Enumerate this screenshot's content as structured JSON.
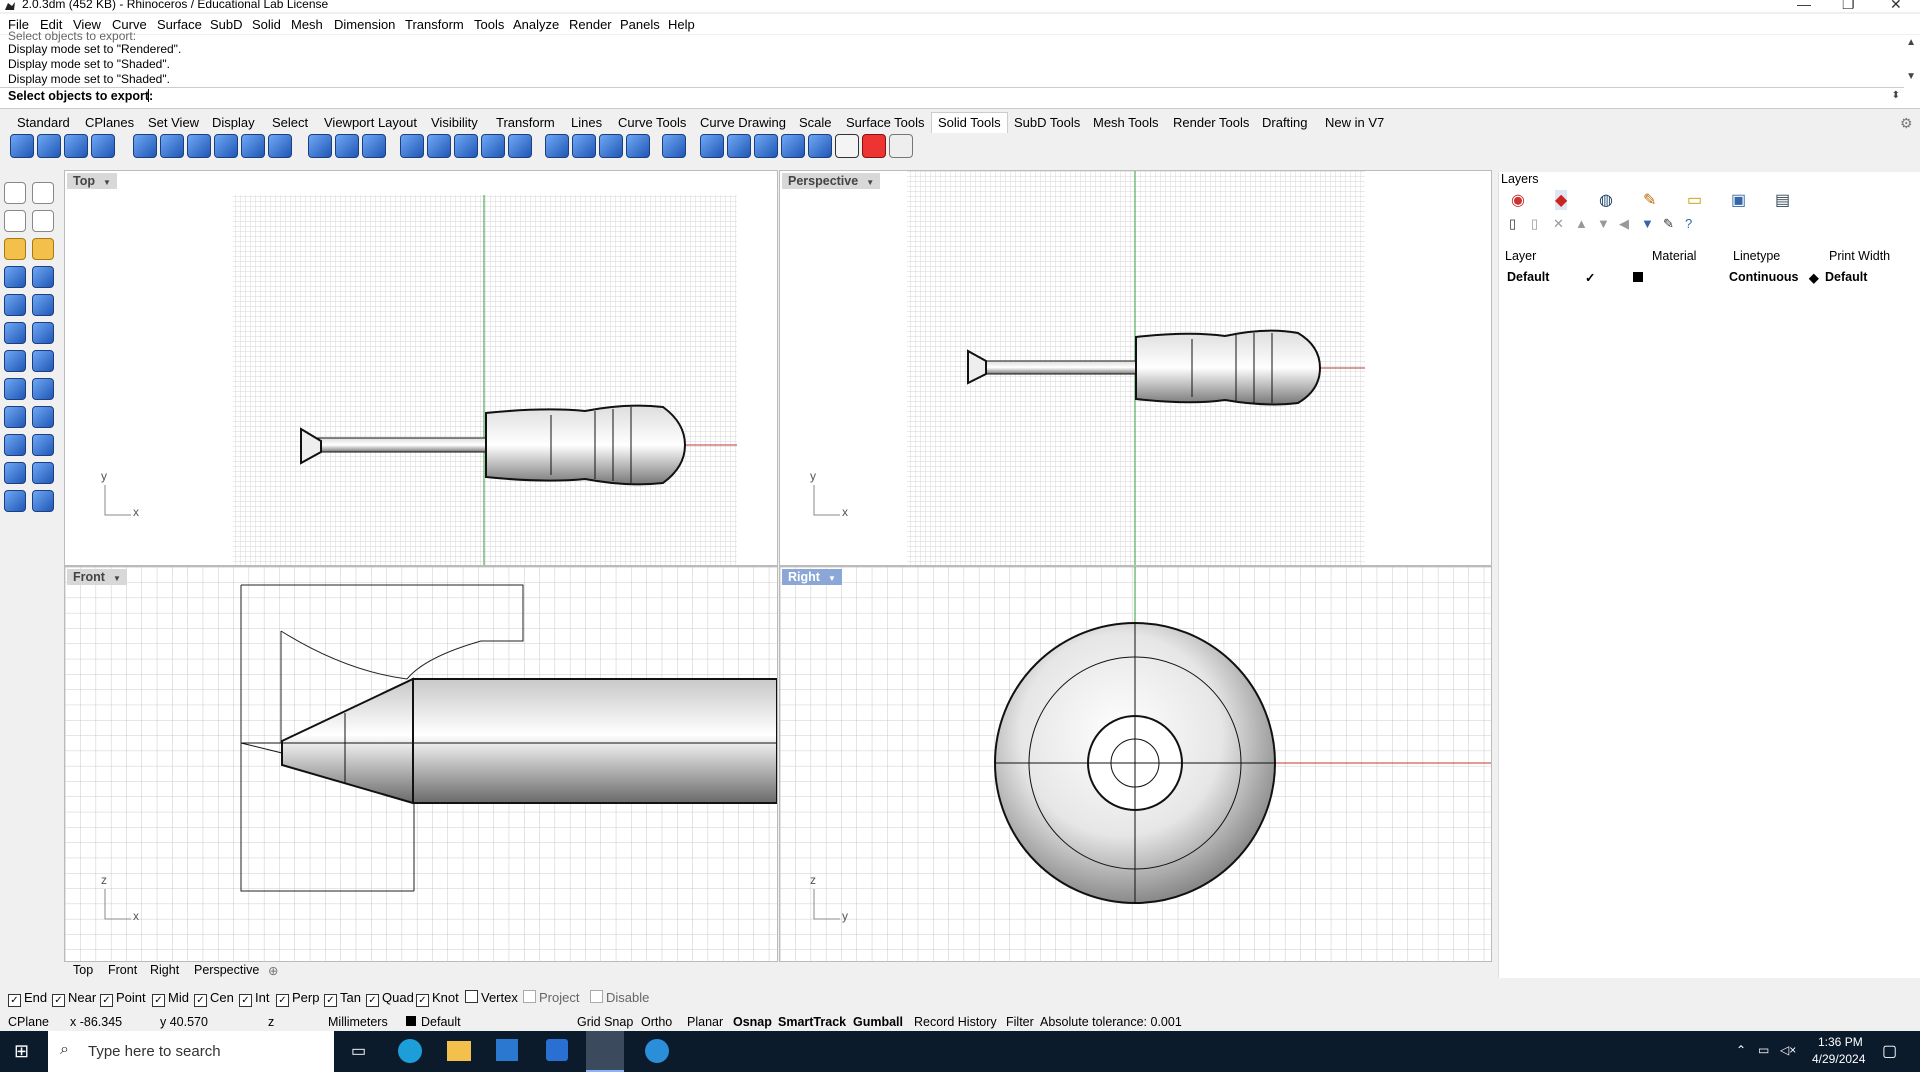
{
  "window": {
    "title": "2.0.3dm (452 KB) - Rhinoceros / Educational Lab License"
  },
  "menu": [
    "File",
    "Edit",
    "View",
    "Curve",
    "Surface",
    "SubD",
    "Solid",
    "Mesh",
    "Dimension",
    "Transform",
    "Tools",
    "Analyze",
    "Render",
    "Panels",
    "Help"
  ],
  "command": {
    "history": [
      "Select objects to export:",
      "Display mode set to \"Rendered\".",
      "Display mode set to \"Shaded\".",
      "Display mode set to \"Shaded\"."
    ],
    "prompt": "Select objects to export:"
  },
  "toolbar_tabs": [
    "Standard",
    "CPlanes",
    "Set View",
    "Display",
    "Select",
    "Viewport Layout",
    "Visibility",
    "Transform",
    "Lines",
    "Curve Tools",
    "Curve Drawing",
    "Scale",
    "Surface Tools",
    "Solid Tools",
    "SubD Tools",
    "Mesh Tools",
    "Render Tools",
    "Drafting",
    "New in V7"
  ],
  "active_tab": "Solid Tools",
  "viewports": {
    "top": "Top",
    "perspective": "Perspective",
    "front": "Front",
    "right": "Right"
  },
  "axis_labels": {
    "x": "x",
    "y": "y",
    "z": "z"
  },
  "view_tabs": [
    "Top",
    "Front",
    "Right",
    "Perspective"
  ],
  "layers": {
    "title": "Layers",
    "columns": [
      "Layer",
      "Material",
      "Linetype",
      "Print Width"
    ],
    "rows": [
      {
        "name": "Default",
        "check": "✓",
        "linetype": "Continuous",
        "print_width": "Default"
      }
    ]
  },
  "osnap": [
    {
      "label": "End",
      "checked": true
    },
    {
      "label": "Near",
      "checked": true
    },
    {
      "label": "Point",
      "checked": true
    },
    {
      "label": "Mid",
      "checked": true
    },
    {
      "label": "Cen",
      "checked": true
    },
    {
      "label": "Int",
      "checked": true
    },
    {
      "label": "Perp",
      "checked": true
    },
    {
      "label": "Tan",
      "checked": true
    },
    {
      "label": "Quad",
      "checked": true
    },
    {
      "label": "Knot",
      "checked": true
    },
    {
      "label": "Vertex",
      "checked": false
    },
    {
      "label": "Project",
      "checked": false
    },
    {
      "label": "Disable",
      "checked": false
    }
  ],
  "status": {
    "cplane": "CPlane",
    "x": "x -86.345",
    "y": "y 40.570",
    "z": "z",
    "units": "Millimeters",
    "layer": "Default",
    "toggles": [
      "Grid Snap",
      "Ortho",
      "Planar",
      "Osnap",
      "SmartTrack",
      "Gumball",
      "Record History",
      "Filter"
    ],
    "tolerance": "Absolute tolerance: 0.001"
  },
  "taskbar": {
    "search_placeholder": "Type here to search",
    "time": "1:36 PM",
    "date": "4/29/2024"
  },
  "colors": {
    "accent": "#8aa7d6",
    "x_axis": "#c0392b",
    "y_axis": "#2e9e3b",
    "taskbar": "#0c1b2c"
  }
}
